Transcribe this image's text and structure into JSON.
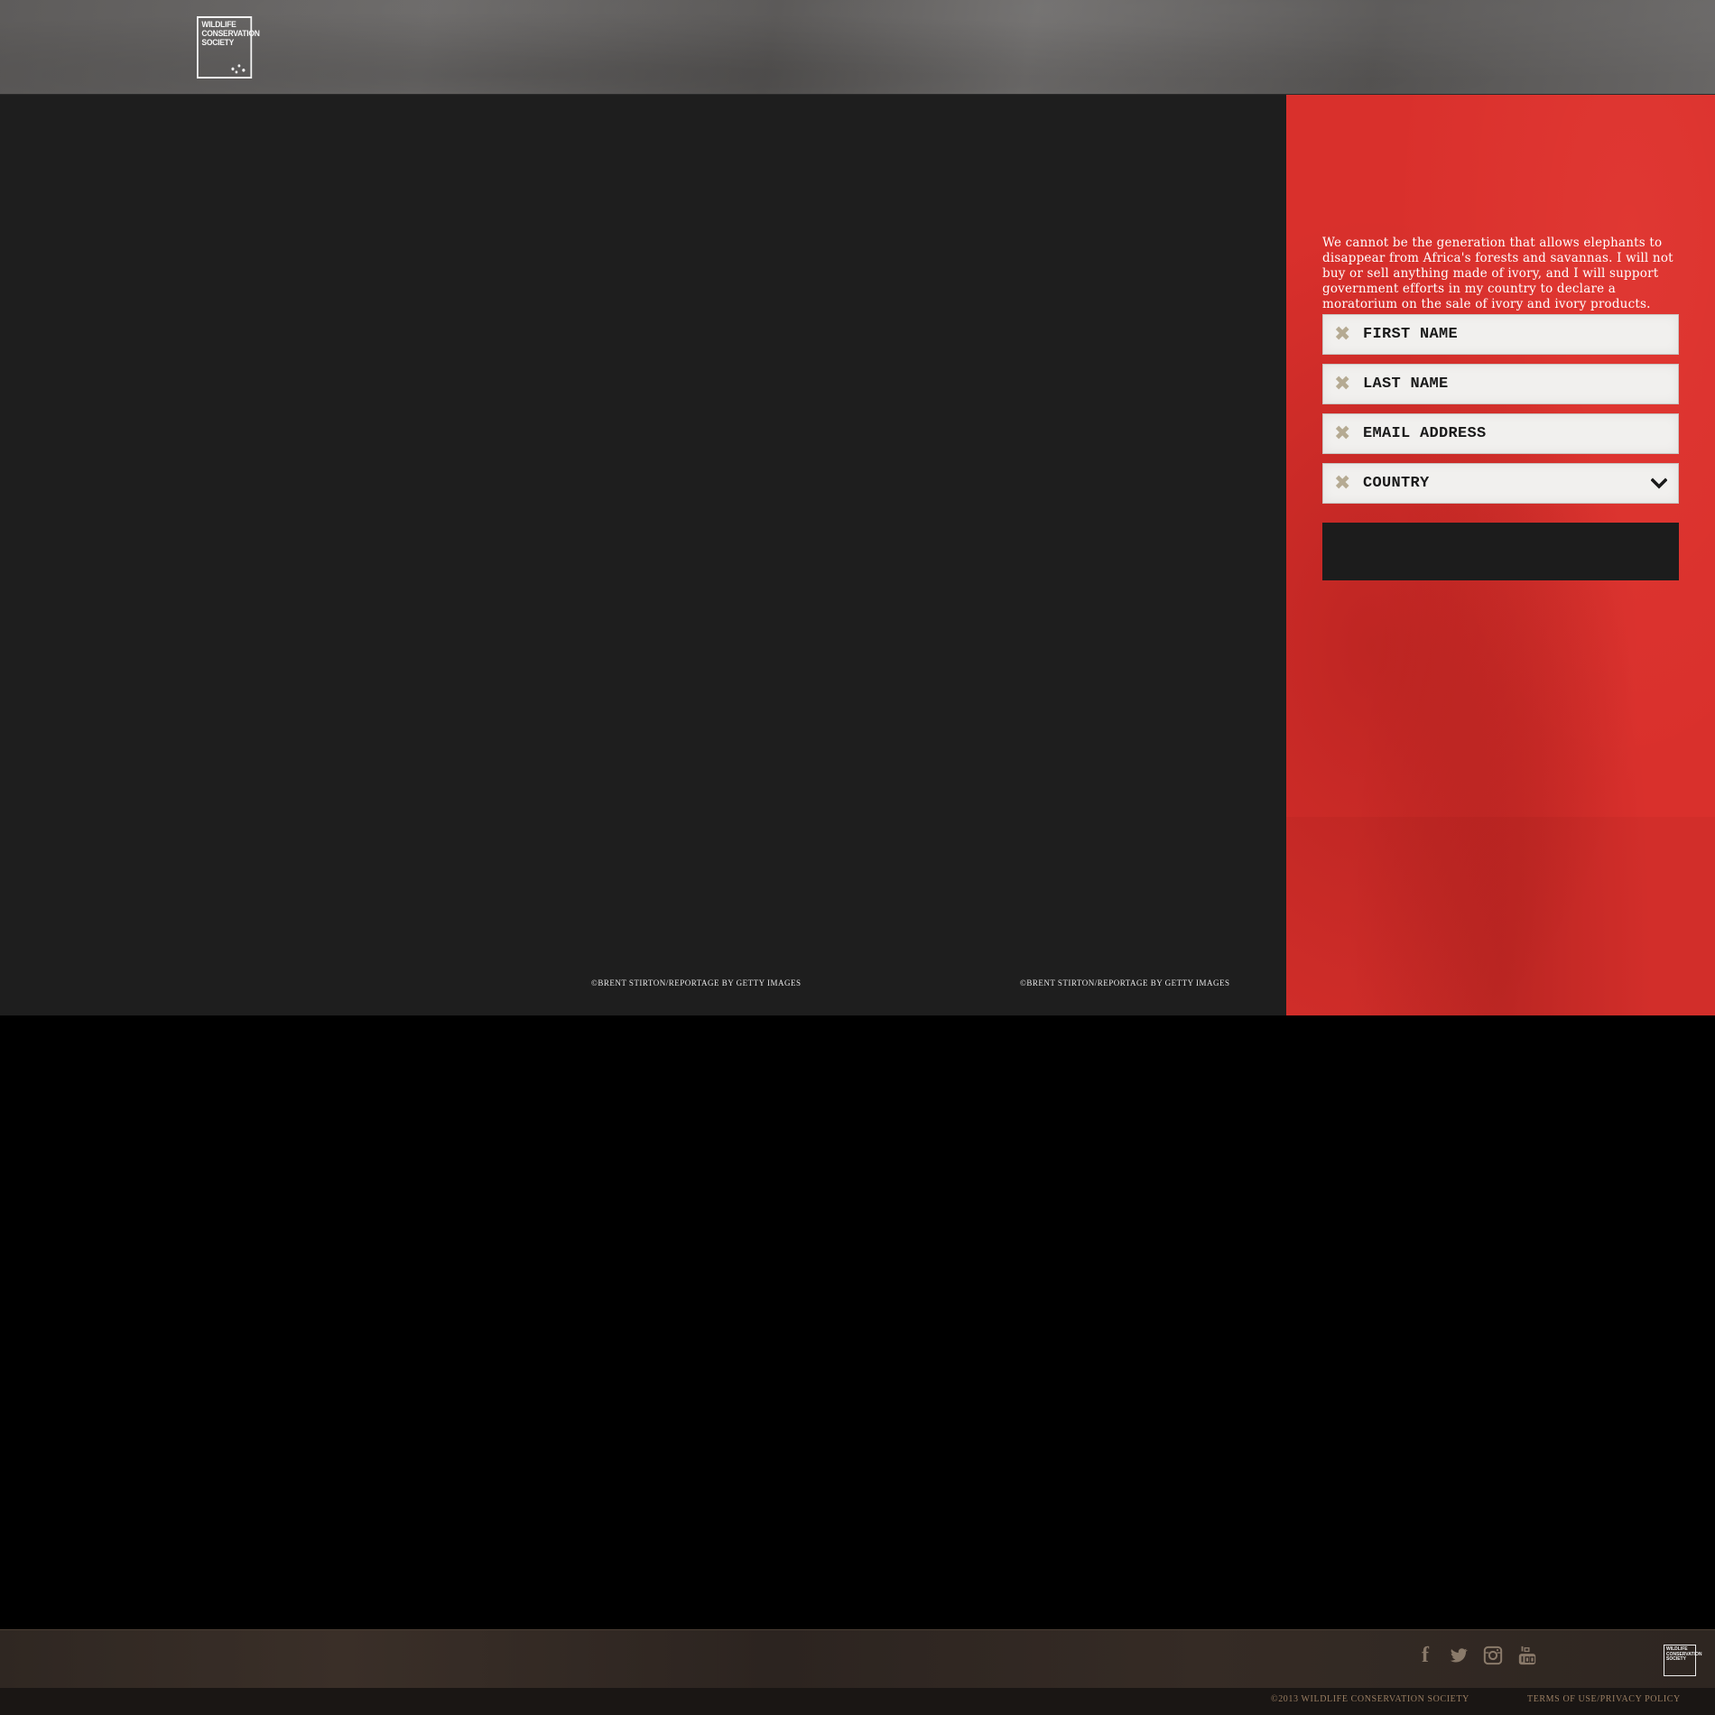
{
  "header": {
    "logo_lines": [
      "WILDLIFE",
      "CONSERVATION",
      "SOCIETY"
    ]
  },
  "hero": {
    "credits": [
      "©Brent Stirton/Reportage by Getty Images",
      "©Brent Stirton/Reportage by Getty Images"
    ]
  },
  "pledge": {
    "text": "We cannot be the generation that allows elephants to disappear from Africa's forests and savannas. I will not buy or sell anything made of ivory, and I will support government efforts in my country to declare a moratorium on the sale of ivory and ivory products.",
    "fields": {
      "first_name": {
        "placeholder": "FIRST NAME"
      },
      "last_name": {
        "placeholder": "LAST NAME"
      },
      "email": {
        "placeholder": "EMAIL ADDRESS"
      },
      "country": {
        "value": "COUNTRY"
      }
    },
    "colors": {
      "panel": "#d9302c",
      "field_icon": "#b5aa92",
      "submit": "#1c1c1c"
    }
  },
  "footer": {
    "social_icons": [
      "facebook-icon",
      "twitter-icon",
      "instagram-icon",
      "youtube-icon"
    ],
    "copyright": "©2013 Wildlife Conservation Society",
    "terms": "Terms of Use/Privacy Policy",
    "logo_lines": [
      "WILDLIFE",
      "CONSERVATION",
      "SOCIETY"
    ]
  }
}
